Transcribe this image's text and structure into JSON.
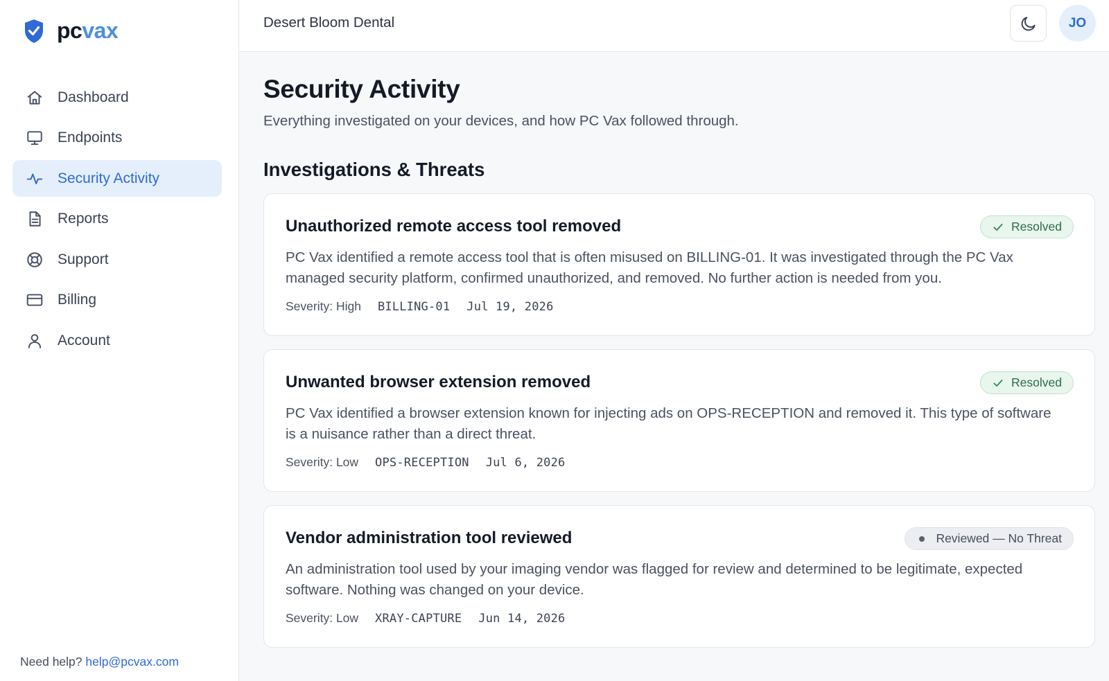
{
  "brand": {
    "pc": "pc",
    "vax": "vax",
    "accent": "#4a8fe0"
  },
  "sidebar": {
    "items": [
      {
        "label": "Dashboard",
        "icon": "home-icon"
      },
      {
        "label": "Endpoints",
        "icon": "monitor-icon"
      },
      {
        "label": "Security Activity",
        "icon": "activity-icon",
        "active": true
      },
      {
        "label": "Reports",
        "icon": "document-icon"
      },
      {
        "label": "Support",
        "icon": "lifebuoy-icon"
      },
      {
        "label": "Billing",
        "icon": "credit-card-icon"
      },
      {
        "label": "Account",
        "icon": "user-icon"
      }
    ],
    "help_prefix": "Need help?",
    "help_email": "help@pcvax.com"
  },
  "header": {
    "org_name": "Desert Bloom Dental",
    "avatar_initials": "JO",
    "theme_icon": "moon-icon"
  },
  "main": {
    "title": "Security Activity",
    "subtitle": "Everything investigated on your devices, and how PC Vax followed through.",
    "section_title": "Investigations & Threats",
    "cards": [
      {
        "title": "Unauthorized remote access tool removed",
        "status": "Resolved",
        "status_color": "#2f8a55",
        "description": "PC Vax identified a remote access tool that is often misused on BILLING-01. It was investigated through the PC Vax managed security platform, confirmed unauthorized, and removed. No further action is needed from you.",
        "severity": "Severity: High",
        "device": "BILLING-01",
        "date": "Jul 19, 2026"
      },
      {
        "title": "Unwanted browser extension removed",
        "status": "Resolved",
        "status_color": "#2f8a55",
        "description": "PC Vax identified a browser extension known for injecting ads on OPS-RECEPTION and removed it. This type of software is a nuisance rather than a direct threat.",
        "severity": "Severity: Low",
        "device": "OPS-RECEPTION",
        "date": "Jul 6, 2026"
      },
      {
        "title": "Vendor administration tool reviewed",
        "status": "Reviewed — No Threat",
        "status_color": "#5a6170",
        "description": "An administration tool used by your imaging vendor was flagged for review and determined to be legitimate, expected software. Nothing was changed on your device.",
        "severity": "Severity: Low",
        "device": "XRAY-CAPTURE",
        "date": "Jun 14, 2026"
      }
    ]
  }
}
